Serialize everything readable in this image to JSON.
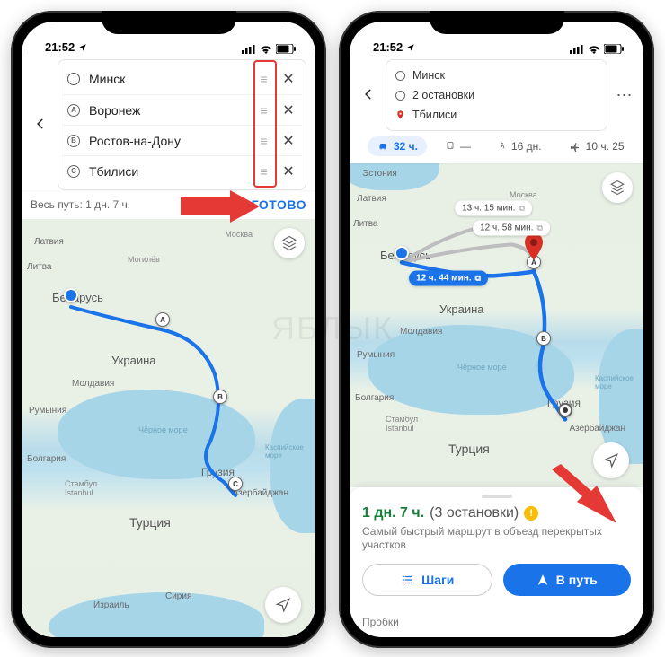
{
  "status": {
    "time": "21:52",
    "location_icon": true
  },
  "left": {
    "stops": [
      {
        "mark": "o",
        "label": "Минск"
      },
      {
        "mark": "A",
        "label": "Воронеж"
      },
      {
        "mark": "B",
        "label": "Ростов-на-Дону"
      },
      {
        "mark": "C",
        "label": "Тбилиси"
      }
    ],
    "total_label": "Весь путь: 1 дн. 7 ч.",
    "done": "ГОТОВО",
    "map_labels": {
      "latvia": "Латвия",
      "lithuania": "Литва",
      "belarus": "Беларусь",
      "ukraine": "Украина",
      "moldova": "Молдавия",
      "romania": "Румыния",
      "bulgaria": "Болгария",
      "turkey": "Турция",
      "georgia": "Грузия",
      "azerbaijan": "Азербайджан",
      "syria": "Сирия",
      "israel": "Израиль",
      "black_sea": "Чёрное море",
      "caspian": "Каспийское море",
      "moscow": "Москва",
      "istanbul": "Стамбул\nIstanbul",
      "mogilev": "Могилёв"
    }
  },
  "right": {
    "summary": {
      "from": "Минск",
      "stops_line": "2 остановки",
      "to": "Тбилиси"
    },
    "modes": {
      "drive": "32 ч.",
      "transit": "—",
      "walk": "16 дн.",
      "fly": "10 ч. 25"
    },
    "map_labels": {
      "estonia": "Эстония",
      "latvia": "Латвия",
      "lithuania": "Литва",
      "belarus": "Беларусь",
      "ukraine": "Украина",
      "moldova": "Молдавия",
      "romania": "Румыния",
      "bulgaria": "Болгария",
      "turkey": "Турция",
      "georgia": "Грузия",
      "azerbaijan": "Азербайджан",
      "black_sea": "Чёрное море",
      "caspian": "Каспийское море",
      "moscow": "Москва",
      "istanbul": "Стамбул\nIstanbul"
    },
    "chips": {
      "a": "13 ч. 15 мин.",
      "b": "12 ч. 58 мин.",
      "c": "12 ч. 44 мин."
    },
    "sheet": {
      "duration": "1 дн. 7 ч.",
      "stops": "(3 остановки)",
      "subtitle": "Самый быстрый маршрут в объезд перекрытых участков",
      "steps": "Шаги",
      "go": "В путь",
      "tab_traffic": "Пробки"
    }
  },
  "watermark": "ЯБЛЫК"
}
